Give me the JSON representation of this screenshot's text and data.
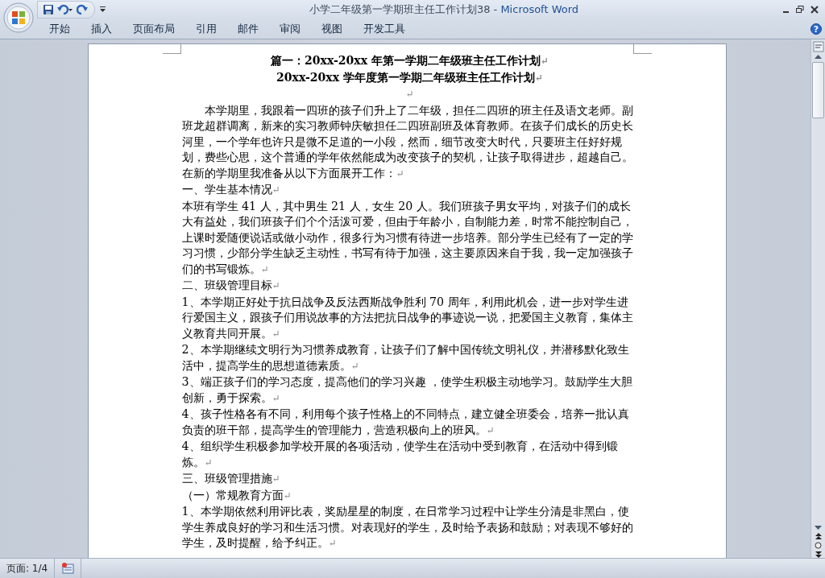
{
  "window": {
    "document_title": "小学二年级第一学期班主任工作计划38",
    "separator": "-",
    "app_name": "Microsoft Word"
  },
  "ribbon_tabs": [
    {
      "label": "开始",
      "selected": false
    },
    {
      "label": "插入",
      "selected": false
    },
    {
      "label": "页面布局",
      "selected": false
    },
    {
      "label": "引用",
      "selected": false
    },
    {
      "label": "邮件",
      "selected": false
    },
    {
      "label": "审阅",
      "selected": false
    },
    {
      "label": "视图",
      "selected": false
    },
    {
      "label": "开发工具",
      "selected": false
    }
  ],
  "help_button": "?",
  "document": {
    "paragraphs": [
      {
        "kind": "title",
        "text": "篇一：20xx-20xx 年第一学期二年级班主任工作计划",
        "mark": "↵"
      },
      {
        "kind": "title",
        "text": "20xx-20xx 学年度第一学期二年级班主任工作计划",
        "mark": "↵"
      },
      {
        "kind": "empty",
        "mark": "↵"
      },
      {
        "kind": "indented",
        "text": "本学期里，我跟着一四班的孩子们升上了二年级，担任二四班的班主任及语文老师。副班龙超群调离，新来的实习教师钟庆敏担任二四班副班及体育教师。在孩子们成长的历史长河里，一个学年也许只是微不足道的一小段，然而，细节改变大时代，只要班主任好好规划，费些心思，这个普通的学年依然能成为改变孩子的契机，让孩子取得进步，超越自己。在新的学期里我准备从以下方面展开工作：",
        "mark": "↵"
      },
      {
        "kind": "body",
        "text": "一、学生基本情况",
        "mark": "↵"
      },
      {
        "kind": "body",
        "text": "本班有学生 41 人，其中男生 21 人，女生 20 人。我们班孩子男女平均，对孩子们的成长大有益处，我们班孩子们个个活泼可爱，但由于年龄小，自制能力差，时常不能控制自己，上课时爱随便说话或做小动作，很多行为习惯有待进一步培养。部分学生已经有了一定的学习习惯，少部分学生缺乏主动性，书写有待于加强，这主要原因来自于我，我一定加强孩子们的书写锻炼。",
        "mark": "↵"
      },
      {
        "kind": "body",
        "text": "二、班级管理目标",
        "mark": "↵"
      },
      {
        "kind": "body",
        "text": "1、本学期正好处于抗日战争及反法西斯战争胜利 70 周年，利用此机会，进一步对学生进行爱国主义，跟孩子们用说故事的方法把抗日战争的事迹说一说，把爱国主义教育，集体主义教育共同开展。",
        "mark": "↵"
      },
      {
        "kind": "body",
        "text": "2、本学期继续文明行为习惯养成教育，让孩子们了解中国传统文明礼仪，并潜移默化致生活中，提高学生的思想道德素质。",
        "mark": "↵"
      },
      {
        "kind": "body",
        "text": "3、端正孩子们的学习态度，提高他们的学习兴趣 ，使学生积极主动地学习。鼓励学生大胆创新，勇于探索。",
        "mark": "↵"
      },
      {
        "kind": "body",
        "text": "4、孩子性格各有不同，利用每个孩子性格上的不同特点，建立健全班委会，培养一批认真负责的班干部，提高学生的管理能力，营造积极向上的班风。",
        "mark": "↵"
      },
      {
        "kind": "body",
        "text": "4、组织学生积极参加学校开展的各项活动，使学生在活动中受到教育，在活动中得到锻炼。",
        "mark": "↵"
      },
      {
        "kind": "body",
        "text": "三、班级管理措施",
        "mark": "↵"
      },
      {
        "kind": "body",
        "text": "（一）常规教育方面",
        "mark": "↵"
      },
      {
        "kind": "body",
        "text": "1、本学期依然利用评比表，奖励星星的制度，在日常学习过程中让学生分清是非黑白，使学生养成良好的学习和生活习惯。对表现好的学生，及时给予表扬和鼓励；对表现不够好的学生，及时提醒，给予纠正。",
        "mark": "↵"
      }
    ]
  },
  "status_bar": {
    "page": "页面: 1/4"
  }
}
